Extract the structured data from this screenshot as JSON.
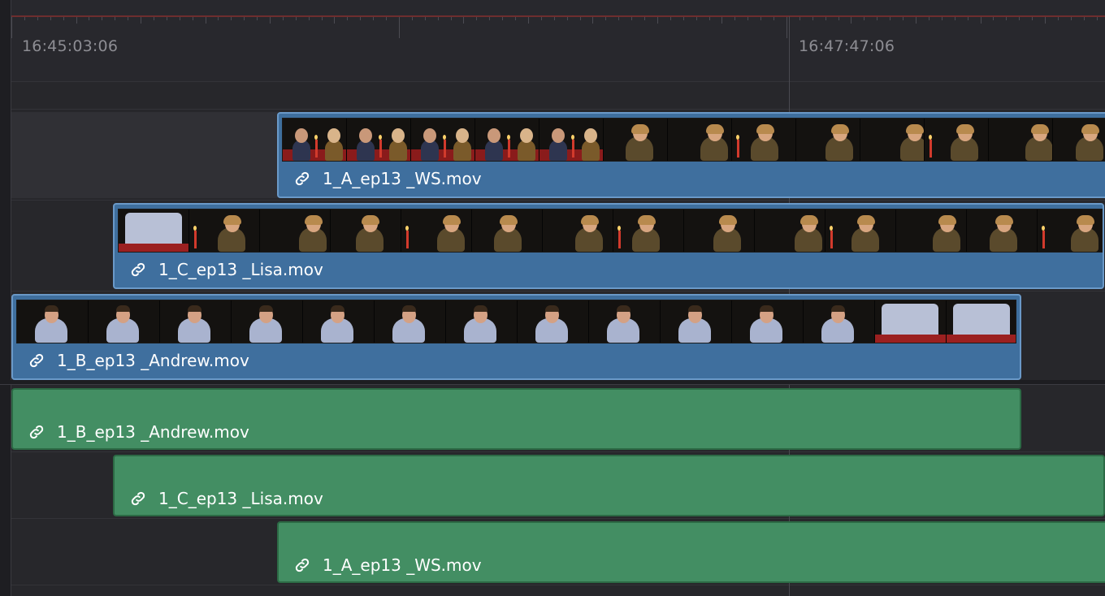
{
  "ruler": {
    "timecode_left": "16:45:03:06",
    "timecode_right": "16:47:47:06"
  },
  "video_tracks": [
    {
      "clip_name": "1_A_ep13 _WS.mov",
      "thumbs": [
        "table-scene",
        "table-scene",
        "table-scene",
        "table-scene",
        "table-scene",
        "woman",
        "woman",
        "woman",
        "woman",
        "woman",
        "woman",
        "woman",
        "woman"
      ]
    },
    {
      "clip_name": "1_C_ep13 _Lisa.mov",
      "thumbs": [
        "hands",
        "woman",
        "woman",
        "woman",
        "woman",
        "woman",
        "woman",
        "woman",
        "woman",
        "woman",
        "woman",
        "woman",
        "woman",
        "woman"
      ]
    },
    {
      "clip_name": "1_B_ep13 _Andrew.mov",
      "thumbs": [
        "man",
        "man",
        "man",
        "man",
        "man",
        "man",
        "man",
        "man",
        "man",
        "man",
        "man",
        "man",
        "hands",
        "hands"
      ]
    }
  ],
  "audio_tracks": [
    {
      "clip_name": "1_B_ep13 _Andrew.mov"
    },
    {
      "clip_name": "1_C_ep13 _Lisa.mov"
    },
    {
      "clip_name": "1_A_ep13 _WS.mov"
    }
  ],
  "colors": {
    "video_clip": "#3f6f9e",
    "audio_clip": "#438e63",
    "background": "#27272b"
  },
  "icons": {
    "clip_link": "link-icon"
  }
}
